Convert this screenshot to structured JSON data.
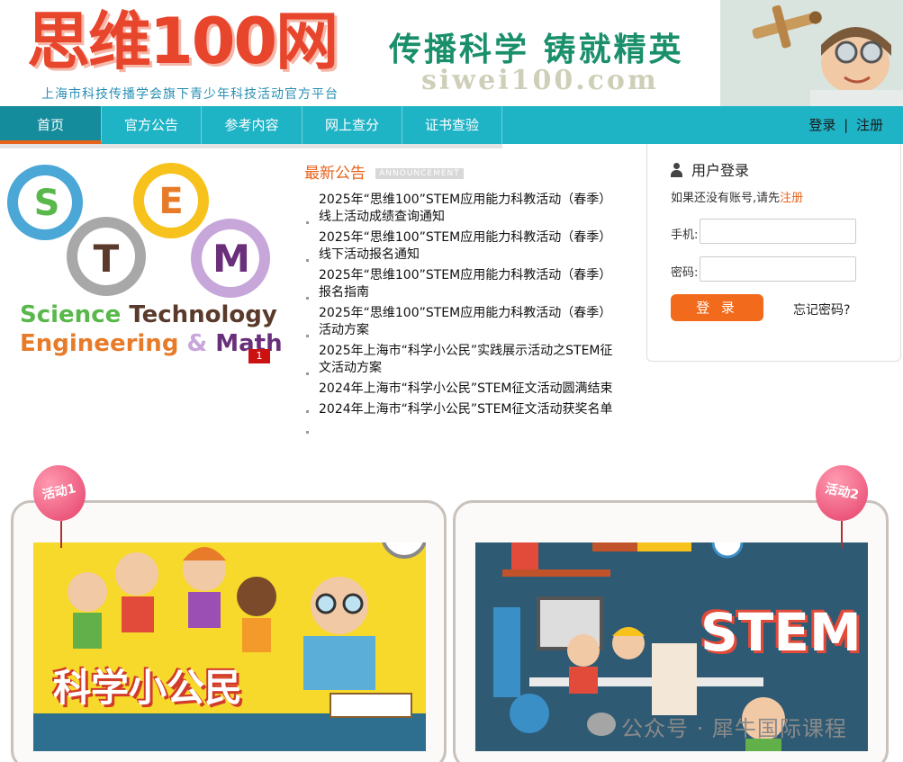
{
  "header": {
    "logo_text": "思维100网",
    "logo_subtitle": "上海市科技传播学会旗下青少年科技活动官方平台",
    "slogan": "传播科学 铸就精英",
    "domain": "siwei100.com"
  },
  "nav": {
    "items": [
      {
        "label": "首页"
      },
      {
        "label": "官方公告"
      },
      {
        "label": "参考内容"
      },
      {
        "label": "网上查分"
      },
      {
        "label": "证书查验"
      }
    ],
    "login": "登录",
    "separator": "|",
    "register": "注册"
  },
  "carousel": {
    "letters": [
      "S",
      "T",
      "E",
      "M"
    ],
    "line1_a": "Science",
    "line1_b": "Technology",
    "line2_a": "Engineering",
    "line2_b": "&",
    "line2_c": "Math",
    "slide_number": "1"
  },
  "announcements": {
    "title": "最新公告",
    "tag": "ANNOUNCEMENT",
    "items": [
      "2025年“思维100”STEM应用能力科教活动（春季）线上活动成绩查询通知",
      "2025年“思维100”STEM应用能力科教活动（春季） 线下活动报名通知",
      "2025年“思维100”STEM应用能力科教活动（春季）报名指南",
      "2025年“思维100”STEM应用能力科教活动（春季）活动方案",
      "2025年上海市“科学小公民”实践展示活动之STEM征文活动方案",
      "2024年上海市“科学小公民”STEM征文活动圆满结束",
      "2024年上海市“科学小公民”STEM征文活动获奖名单"
    ]
  },
  "login": {
    "title": "用户登录",
    "hint": "如果还没有账号,请先",
    "hint_link": "注册",
    "phone_label": "手机:",
    "password_label": "密码:",
    "button": "登 录",
    "forgot": "忘记密码?"
  },
  "activities": [
    {
      "badge": "活动1",
      "title": "科学小公民"
    },
    {
      "badge": "活动2",
      "title": "STEM"
    }
  ],
  "watermark": "公众号 · 犀牛国际课程",
  "colors": {
    "nav": "#1fb3c6",
    "nav_active": "#158c9c",
    "accent": "#e7621a",
    "logo": "#e8462c",
    "slogan": "#1a8f6b"
  }
}
